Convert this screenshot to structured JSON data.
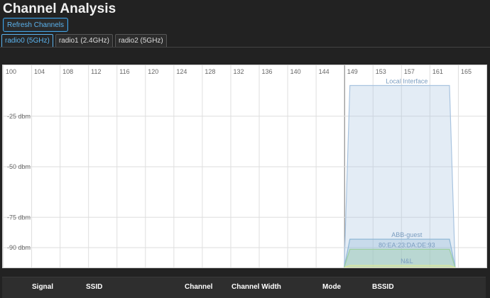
{
  "page": {
    "title": "Channel Analysis"
  },
  "toolbar": {
    "refresh_label": "Refresh Channels"
  },
  "tabs": [
    {
      "label": "radio0 (5GHz)",
      "active": true
    },
    {
      "label": "radio1 (2.4GHz)",
      "active": false
    },
    {
      "label": "radio2 (5GHz)",
      "active": false
    }
  ],
  "chart_data": {
    "type": "area",
    "x_ticks": [
      100,
      104,
      108,
      112,
      116,
      120,
      124,
      128,
      132,
      136,
      140,
      144,
      149,
      153,
      157,
      161,
      165
    ],
    "y_ticks": [
      {
        "label": "-25 dbm",
        "value": -25
      },
      {
        "label": "-50 dbm",
        "value": -50
      },
      {
        "label": "-75 dbm",
        "value": -75
      },
      {
        "label": "-90 dbm",
        "value": -90
      }
    ],
    "grid": true,
    "series": [
      {
        "name": "Local Interface",
        "signal": -10,
        "channel_start": 149,
        "channel_end": 161,
        "color": "#a9c4e0"
      },
      {
        "name": "ABB-guest",
        "signal": -86,
        "channel_start": 149,
        "channel_end": 161,
        "color": "#8fb7d6"
      },
      {
        "name": "80:EA:23:DA:DE:93",
        "signal": -91,
        "channel_start": 149,
        "channel_end": 161,
        "color": "#9ccfa0"
      },
      {
        "name": "N&L",
        "signal": -99,
        "channel_start": 149,
        "channel_end": 161,
        "color": "#d9e79a"
      }
    ]
  },
  "table": {
    "columns": [
      "Signal",
      "SSID",
      "Channel",
      "Channel Width",
      "Mode",
      "BSSID"
    ]
  }
}
